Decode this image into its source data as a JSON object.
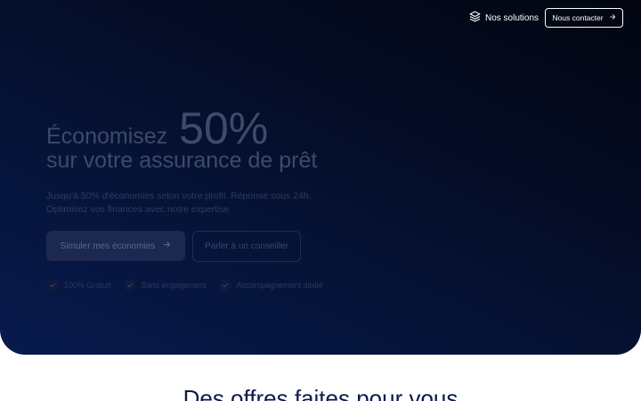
{
  "nav": {
    "solutions_label": "Nos solutions",
    "solutions_icon": "layers-icon",
    "contact_label": "Nous contacter",
    "contact_icon": "arrow-right-icon"
  },
  "hero": {
    "headline_word": "Économisez",
    "headline_percent": "50%",
    "headline_line2": "sur votre assurance de prêt",
    "subtext_line1": "Jusqu'à 50% d'économies selon votre profil. Réponse sous 24h.",
    "subtext_line2": "Optimisez vos finances avec notre expertise",
    "cta_primary": "Simuler mes économies",
    "cta_secondary": "Parler à un conseiller",
    "badges": [
      {
        "label": "100% Gratuit",
        "icon": "check-icon"
      },
      {
        "label": "Sans engagement",
        "icon": "check-icon"
      },
      {
        "label": "Accompagnement dédié",
        "icon": "check-icon"
      }
    ]
  },
  "offers": {
    "title": "Des offres faites pour vous"
  },
  "colors": {
    "hero_gradient_dark": "#020611",
    "hero_gradient_light": "#071a4d",
    "title_navy": "#0b1a4a",
    "white": "#ffffff"
  }
}
